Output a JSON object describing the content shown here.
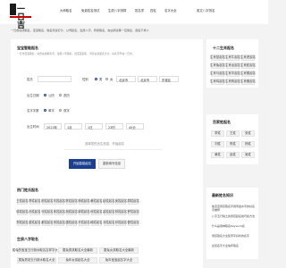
{
  "logo": {
    "text": "一日吉"
  },
  "nav": [
    "大师取名",
    "免费姓名测试",
    "生辰八字测算",
    "姓名学",
    "四柱",
    "名字大全",
    "英文八字测名"
  ],
  "banner": "一日吉在线取名，宝宝取名，姓名测试打分，公司起名，生辰八字，周易取名，吉凶测试等一应俱全，起名不求人",
  "form": {
    "title": "宝宝智能起名",
    "note": "一日吉宝宝取名，免费在线取名字，生辰八字取名，给宝宝起名，男孩女孩起名大全，好名字尽在一日吉。",
    "surname_label": "姓氏",
    "surname_value": "",
    "gender_label": "性别",
    "gender_male": "男",
    "gender_female": "女",
    "region_label": "出生地",
    "region_values": [
      "北京市",
      "北京市",
      "东城区"
    ],
    "dob_type_label": "出生日期",
    "dob_type_options": [
      "公历",
      "农历"
    ],
    "time_label": "出生时间",
    "time_values": [
      "2023年",
      "1月",
      "1日",
      "23时",
      "45分"
    ],
    "length_label": "名字字数",
    "length_options": [
      "单字",
      "双字"
    ],
    "hint": "选择您的出生信息，开始起名",
    "submit": "开始智能起名",
    "reset": "重新填写信息"
  },
  "popular": {
    "title": "热门姓氏起名",
    "chips": [
      [
        "王姓起名",
        "李姓起名",
        "张姓起名",
        "刘姓起名",
        "陈姓起名",
        "杨姓起名",
        "黄姓起名",
        "赵姓起名",
        "吴姓起名",
        "周姓起名"
      ],
      [
        "徐姓起名",
        "孙姓起名",
        "马姓起名",
        "朱姓起名",
        "胡姓起名",
        "郭姓起名",
        "何姓起名",
        "高姓起名",
        "林姓起名",
        "罗姓起名"
      ],
      [
        "郑姓起名",
        "梁姓起名",
        "谢姓起名",
        "宋姓起名",
        "唐姓起名",
        "许姓起名",
        "韩姓起名",
        "冯姓起名",
        "邓姓起名",
        "曹姓起名"
      ]
    ]
  },
  "lucky": {
    "title": "生辰八字取名",
    "chips": [
      [
        "属兔的宝宝五行缺水取名吉祥字大全",
        "属兔男孩取名大全最新",
        "属兔女孩取名大全最新"
      ],
      [
        "属兔男孩五行缺水取名大全",
        "兔年女孩起名大全",
        "兔年宝宝起名字大全"
      ]
    ]
  },
  "zodiac": {
    "title": "十二生肖起名",
    "items": [
      "生肖鼠起名",
      "生肖牛起名",
      "生肖虎起名",
      "生肖兔起名",
      "生肖龙起名",
      "生肖蛇起名",
      "生肖马起名",
      "生肖羊起名",
      "生肖猴起名",
      "生肖鸡起名",
      "生肖狗起名",
      "生肖猪起名"
    ]
  },
  "five": {
    "title": "百家姓起名",
    "items": [
      "李姓",
      "王姓",
      "张姓",
      "刘姓",
      "陈姓",
      "杨姓",
      "黄姓",
      "赵姓",
      "吴姓"
    ]
  },
  "latest": {
    "title": "最新姓名知识",
    "items": [
      "兔宝宝男孩取名字用带金水字的好名字推荐",
      "八字五行缺土的男孩起名技巧和方法",
      "什么是用神取名Keyword名",
      "男孩取名大全集带字好听的名字",
      "女孩名字大全兔年取名"
    ]
  }
}
